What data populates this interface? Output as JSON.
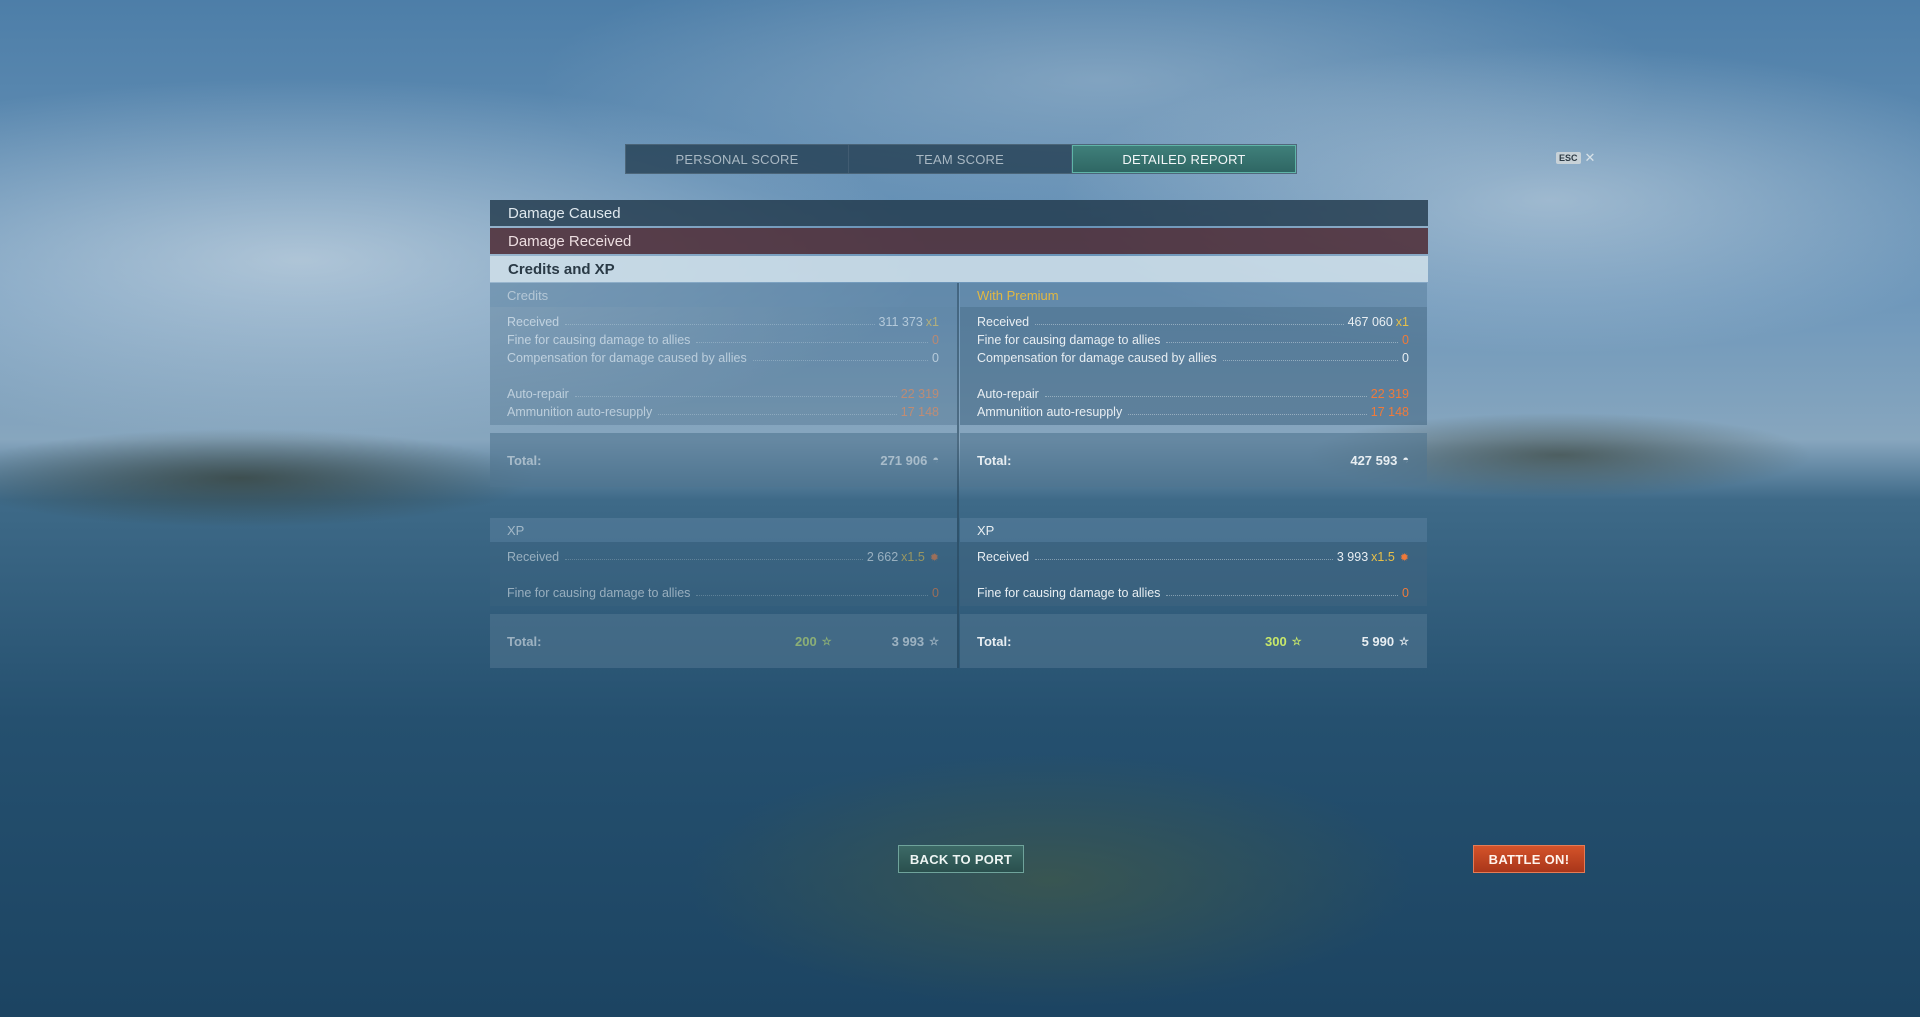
{
  "tabs": [
    {
      "label": "PERSONAL SCORE"
    },
    {
      "label": "TEAM SCORE"
    },
    {
      "label": "DETAILED REPORT"
    }
  ],
  "esc": {
    "key": "ESC",
    "close": "✕"
  },
  "sections": {
    "damage_caused": "Damage Caused",
    "damage_received": "Damage Received",
    "credits_xp": "Credits and XP"
  },
  "credits": {
    "base": {
      "title": "Credits",
      "received_label": "Received",
      "received_value": "311 373",
      "received_mult": "x1",
      "fine_label": "Fine for causing damage to allies",
      "fine_value": "0",
      "comp_label": "Compensation for damage caused by allies",
      "comp_value": "0",
      "repair_label": "Auto-repair",
      "repair_value": "22 319",
      "resupply_label": "Ammunition auto-resupply",
      "resupply_value": "17 148",
      "total_label": "Total:",
      "total_value": "271 906"
    },
    "premium": {
      "title": "With Premium",
      "received_label": "Received",
      "received_value": "467 060",
      "received_mult": "x1",
      "fine_label": "Fine for causing damage to allies",
      "fine_value": "0",
      "comp_label": "Compensation for damage caused by allies",
      "comp_value": "0",
      "repair_label": "Auto-repair",
      "repair_value": "22 319",
      "resupply_label": "Ammunition auto-resupply",
      "resupply_value": "17 148",
      "total_label": "Total:",
      "total_value": "427 593"
    }
  },
  "xp": {
    "base": {
      "title": "XP",
      "received_label": "Received",
      "received_value": "2 662",
      "received_mult": "x1.5",
      "fine_label": "Fine for causing damage to allies",
      "fine_value": "0",
      "total_label": "Total:",
      "total_free": "200",
      "total_value": "3 993"
    },
    "premium": {
      "title": "XP",
      "received_label": "Received",
      "received_value": "3 993",
      "received_mult": "x1.5",
      "fine_label": "Fine for causing damage to allies",
      "fine_value": "0",
      "total_label": "Total:",
      "total_free": "300",
      "total_value": "5 990"
    }
  },
  "buttons": {
    "back_to_port": "BACK TO PORT",
    "battle_on": "BATTLE ON!"
  },
  "icons": {
    "credits": "credits-icon",
    "xp_flag": "xp-flag-icon",
    "star": "star-icon",
    "close": "close-icon"
  },
  "colors": {
    "fine": "#f07a3a",
    "premium_title": "#e2b842",
    "free_xp": "#c8e86a",
    "battle_button": "#c2452a",
    "active_tab": "#3f7f7a"
  }
}
